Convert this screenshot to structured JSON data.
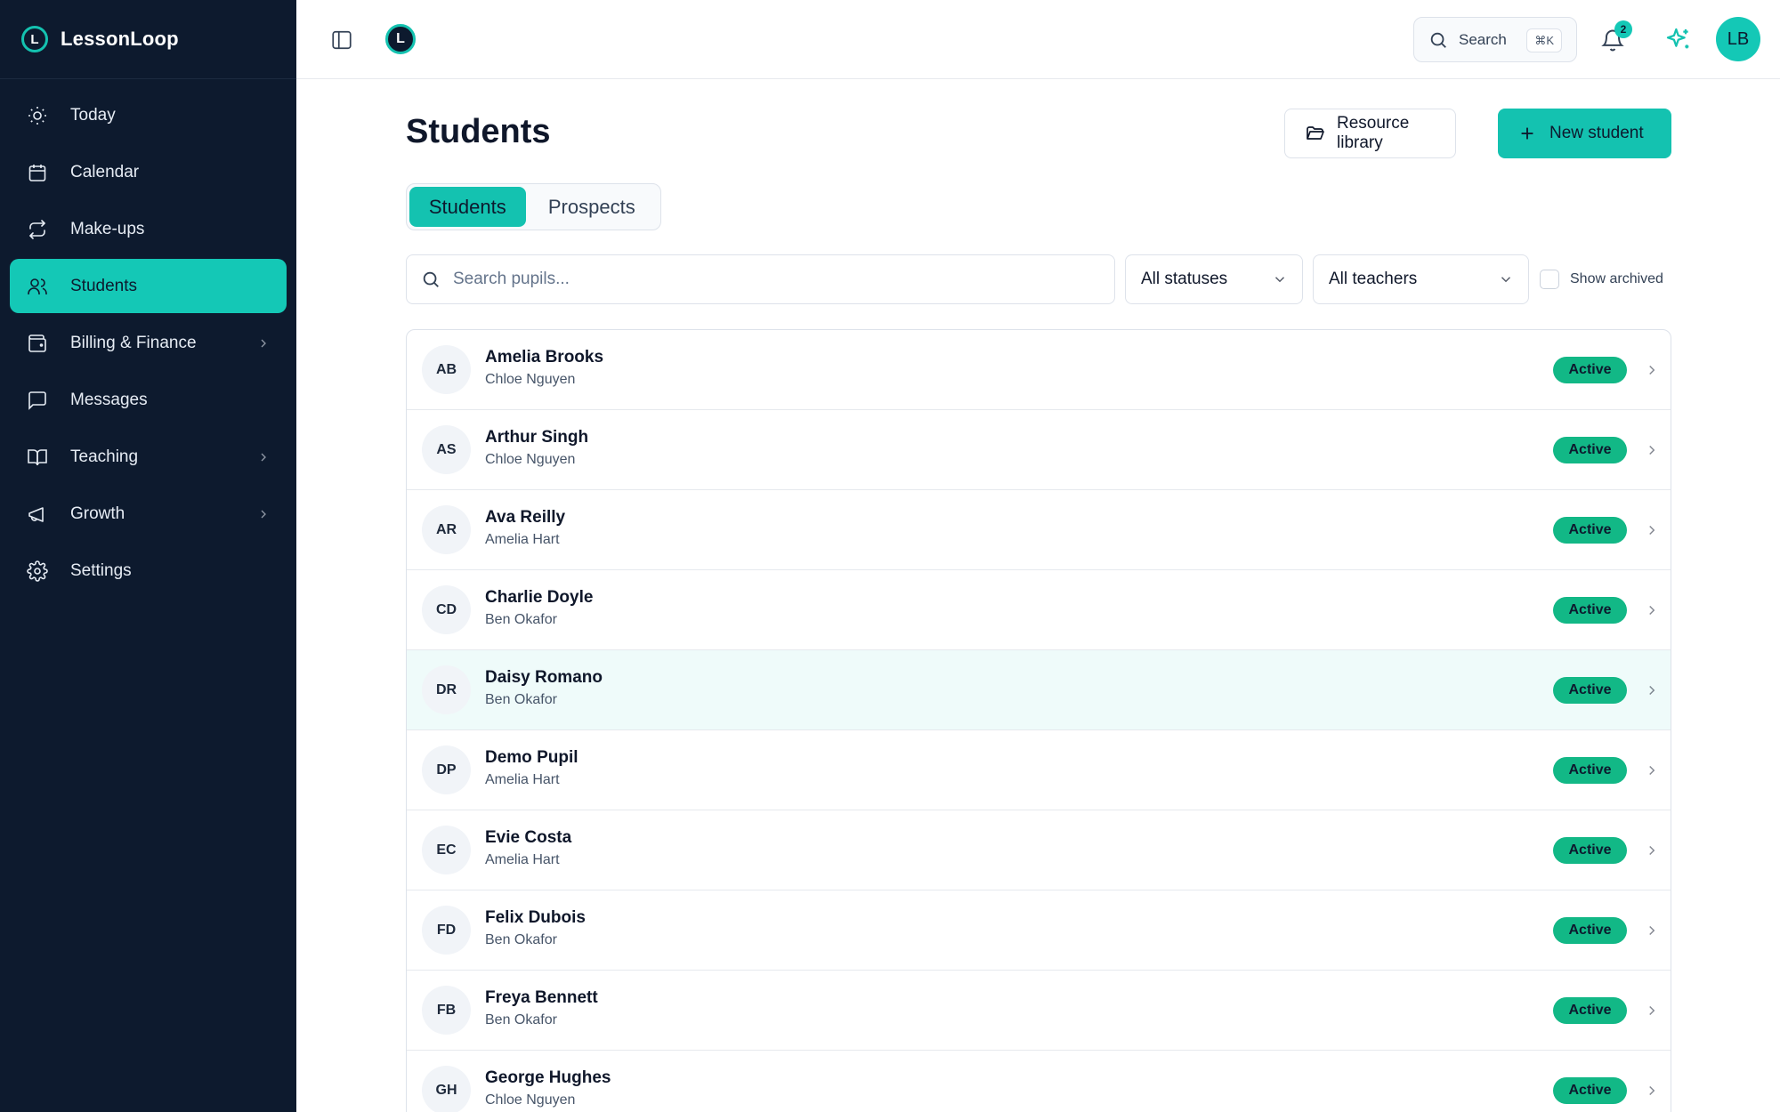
{
  "brand": {
    "name": "LessonLoop",
    "logo_letter": "L"
  },
  "sidebar": {
    "items": [
      {
        "label": "Today",
        "icon": "sun-icon",
        "name": "sidebar-item-today",
        "chevron": false,
        "active": false
      },
      {
        "label": "Calendar",
        "icon": "calendar-icon",
        "name": "sidebar-item-calendar",
        "chevron": false,
        "active": false
      },
      {
        "label": "Make-ups",
        "icon": "repeat-icon",
        "name": "sidebar-item-make-ups",
        "chevron": false,
        "active": false
      },
      {
        "label": "Students",
        "icon": "users-icon",
        "name": "sidebar-item-students",
        "chevron": false,
        "active": true
      },
      {
        "label": "Billing & Finance",
        "icon": "wallet-icon",
        "name": "sidebar-item-billing",
        "chevron": true,
        "active": false
      },
      {
        "label": "Messages",
        "icon": "message-icon",
        "name": "sidebar-item-messages",
        "chevron": false,
        "active": false
      },
      {
        "label": "Teaching",
        "icon": "book-icon",
        "name": "sidebar-item-teaching",
        "chevron": true,
        "active": false
      },
      {
        "label": "Growth",
        "icon": "megaphone-icon",
        "name": "sidebar-item-growth",
        "chevron": true,
        "active": false
      },
      {
        "label": "Settings",
        "icon": "gear-icon",
        "name": "sidebar-item-settings",
        "chevron": false,
        "active": false
      }
    ]
  },
  "topbar": {
    "search_label": "Search",
    "shortcut": "⌘K",
    "notification_count": "2",
    "user_initials": "LB"
  },
  "page": {
    "title": "Students",
    "resource_button": "Resource library",
    "new_button": "New student"
  },
  "tabs": [
    {
      "label": "Students",
      "active": true
    },
    {
      "label": "Prospects",
      "active": false
    }
  ],
  "filters": {
    "search_placeholder": "Search pupils...",
    "status_value": "All statuses",
    "teacher_value": "All teachers",
    "archived_label": "Show archived"
  },
  "students": [
    {
      "initials": "AB",
      "name": "Amelia Brooks",
      "teacher": "Chloe Nguyen",
      "status": "Active"
    },
    {
      "initials": "AS",
      "name": "Arthur Singh",
      "teacher": "Chloe Nguyen",
      "status": "Active"
    },
    {
      "initials": "AR",
      "name": "Ava Reilly",
      "teacher": "Amelia Hart",
      "status": "Active"
    },
    {
      "initials": "CD",
      "name": "Charlie Doyle",
      "teacher": "Ben Okafor",
      "status": "Active"
    },
    {
      "initials": "DR",
      "name": "Daisy Romano",
      "teacher": "Ben Okafor",
      "status": "Active",
      "hover": true
    },
    {
      "initials": "DP",
      "name": "Demo Pupil",
      "teacher": "Amelia Hart",
      "status": "Active"
    },
    {
      "initials": "EC",
      "name": "Evie Costa",
      "teacher": "Amelia Hart",
      "status": "Active"
    },
    {
      "initials": "FD",
      "name": "Felix Dubois",
      "teacher": "Ben Okafor",
      "status": "Active"
    },
    {
      "initials": "FB",
      "name": "Freya Bennett",
      "teacher": "Ben Okafor",
      "status": "Active"
    },
    {
      "initials": "GH",
      "name": "George Hughes",
      "teacher": "Chloe Nguyen",
      "status": "Active"
    }
  ],
  "colors": {
    "sidebar_bg": "#0d1a2e",
    "accent": "#14c2b0",
    "status_active": "#12b886",
    "row_hover": "#effbfa"
  }
}
